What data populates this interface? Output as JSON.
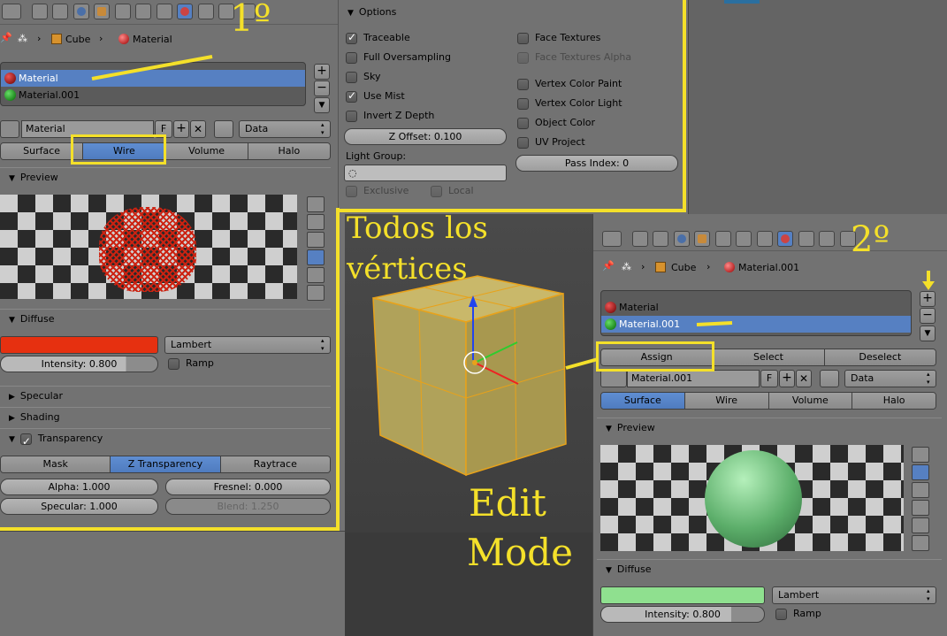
{
  "left": {
    "breadcrumb": {
      "object": "Cube",
      "material": "Material"
    },
    "slots": [
      {
        "name": "Material",
        "color": "#8b0000"
      },
      {
        "name": "Material.001",
        "color": "#2e8b2e"
      }
    ],
    "slot_selected": 0,
    "material_name": "Material",
    "fake_label": "F",
    "data_dropdown": "Data",
    "tabs": [
      "Surface",
      "Wire",
      "Volume",
      "Halo"
    ],
    "tab_active": 1,
    "sections": {
      "preview": "Preview",
      "diffuse": "Diffuse",
      "specular": "Specular",
      "shading": "Shading",
      "transparency": "Transparency"
    },
    "diffuse": {
      "color": "#e63010",
      "shader": "Lambert",
      "intensity_label": "Intensity: 0.800",
      "intensity": 0.8,
      "ramp": "Ramp"
    },
    "transparency_tabs": [
      "Mask",
      "Z Transparency",
      "Raytrace"
    ],
    "transparency_active": 1,
    "alpha": "Alpha: 1.000",
    "fresnel": "Fresnel: 0.000",
    "specular": "Specular: 1.000",
    "blend": "Blend: 1.250"
  },
  "options": {
    "title": "Options",
    "left_checks": [
      {
        "label": "Traceable",
        "checked": true
      },
      {
        "label": "Full Oversampling",
        "checked": false
      },
      {
        "label": "Sky",
        "checked": false
      },
      {
        "label": "Use Mist",
        "checked": true
      },
      {
        "label": "Invert Z Depth",
        "checked": false
      }
    ],
    "right_checks": [
      {
        "label": "Face Textures",
        "checked": false
      },
      {
        "label": "Face Textures Alpha",
        "checked": false,
        "disabled": true
      },
      {
        "label": "Vertex Color Paint",
        "checked": false
      },
      {
        "label": "Vertex Color Light",
        "checked": false
      },
      {
        "label": "Object Color",
        "checked": false
      },
      {
        "label": "UV Project",
        "checked": false
      }
    ],
    "z_offset": "Z Offset: 0.100",
    "light_group": "Light Group:",
    "pass_index": "Pass Index: 0",
    "exclusive": "Exclusive",
    "local": "Local"
  },
  "right": {
    "breadcrumb": {
      "object": "Cube",
      "material": "Material.001"
    },
    "slots": [
      {
        "name": "Material",
        "color": "#8b0000"
      },
      {
        "name": "Material.001",
        "color": "#2e8b2e"
      }
    ],
    "slot_selected": 1,
    "assign": "Assign",
    "select": "Select",
    "deselect": "Deselect",
    "material_name": "Material.001",
    "fake_label": "F",
    "data_dropdown": "Data",
    "tabs": [
      "Surface",
      "Wire",
      "Volume",
      "Halo"
    ],
    "tab_active": 0,
    "sections": {
      "preview": "Preview",
      "diffuse": "Diffuse"
    },
    "diffuse": {
      "color": "#8fe08f",
      "shader": "Lambert",
      "intensity_label": "Intensity: 0.800",
      "intensity": 0.8,
      "ramp": "Ramp"
    }
  },
  "annotations": {
    "first": "1º",
    "second": "2º",
    "todos_line1": "Todos los",
    "todos_line2": "vértices",
    "edit": "Edit",
    "mode": "Mode"
  },
  "colors": {
    "accent": "#5680c2",
    "annotation": "#f4e02a"
  }
}
